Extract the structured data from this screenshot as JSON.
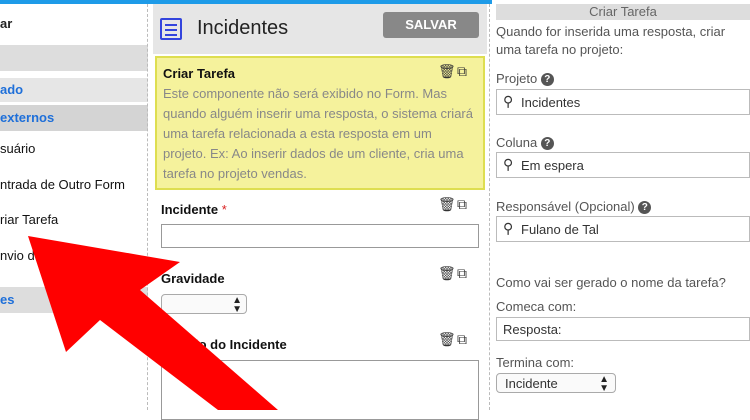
{
  "sidebar": {
    "title": "ar",
    "item_ado": "ado",
    "item_externos": "externos",
    "items": [
      "suário",
      "ntrada de Outro Form",
      "riar Tarefa",
      "nvio d"
    ],
    "item_es": "es"
  },
  "center": {
    "title": "Incidentes",
    "save_label": "SALVAR",
    "component": {
      "title": "Criar Tarefa",
      "text": "Este componente não será exibido no Form. Mas quando alguém inserir uma resposta, o sistema criará uma tarefa relacionada a esta resposta em um projeto. Ex: Ao inserir dados de um cliente, cria uma tarefa no projeto vendas."
    },
    "fields": [
      {
        "label": "Incidente",
        "required": "*"
      },
      {
        "label": "Gravidade"
      },
      {
        "label": "scrição do Incidente"
      }
    ]
  },
  "right": {
    "header": "Criar Tarefa",
    "intro": "Quando for inserida uma resposta, criar uma tarefa no projeto:",
    "projeto_label": "Projeto",
    "projeto_value": "Incidentes",
    "coluna_label": "Coluna",
    "coluna_value": "Em espera",
    "responsavel_label": "Responsável (Opcional)",
    "responsavel_value": "Fulano de Tal",
    "nome_question": "Como vai ser gerado o nome da tarefa?",
    "comeca_label": "Comeca com:",
    "comeca_value": "Resposta:",
    "termina_label": "Termina com:",
    "termina_value": "Incidente"
  },
  "colors": {
    "accent": "#1e9be8",
    "arrow": "#ff0000",
    "highlight": "#f5f29c"
  }
}
